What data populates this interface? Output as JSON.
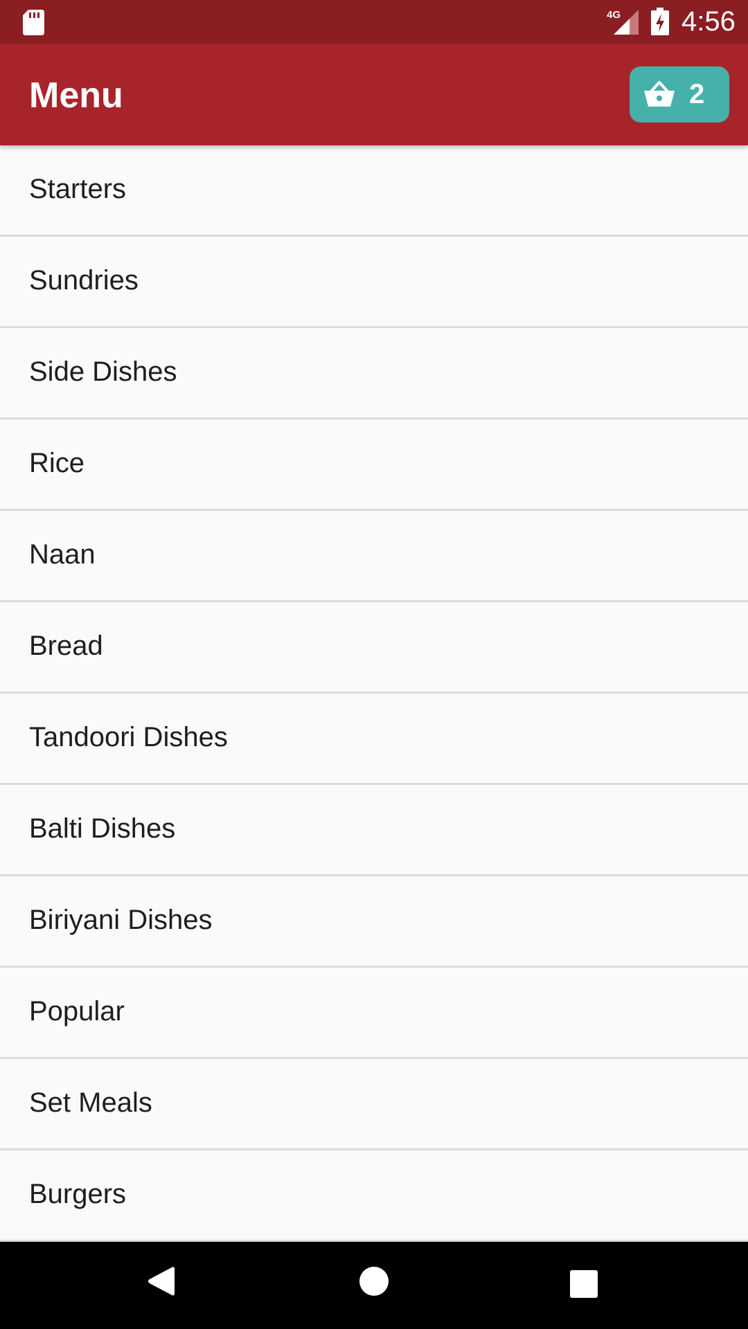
{
  "status_bar": {
    "time": "4:56",
    "network_label": "4G",
    "icons": [
      "sd-card-icon",
      "signal-4g-icon",
      "battery-charging-icon"
    ]
  },
  "app_bar": {
    "title": "Menu",
    "cart_count": "2",
    "cart_icon": "basket-icon",
    "colors": {
      "status_bar": "#8a1e23",
      "app_bar": "#a8242b",
      "cart_button": "#46b1aa"
    }
  },
  "menu": {
    "items": [
      {
        "label": "Starters"
      },
      {
        "label": "Sundries"
      },
      {
        "label": "Side Dishes"
      },
      {
        "label": "Rice"
      },
      {
        "label": "Naan"
      },
      {
        "label": "Bread"
      },
      {
        "label": "Tandoori Dishes"
      },
      {
        "label": "Balti Dishes"
      },
      {
        "label": "Biriyani Dishes"
      },
      {
        "label": "Popular"
      },
      {
        "label": "Set Meals"
      },
      {
        "label": "Burgers"
      },
      {
        "label": ""
      }
    ]
  },
  "nav_bar": {
    "icons": [
      "back-icon",
      "home-icon",
      "recents-icon"
    ]
  }
}
